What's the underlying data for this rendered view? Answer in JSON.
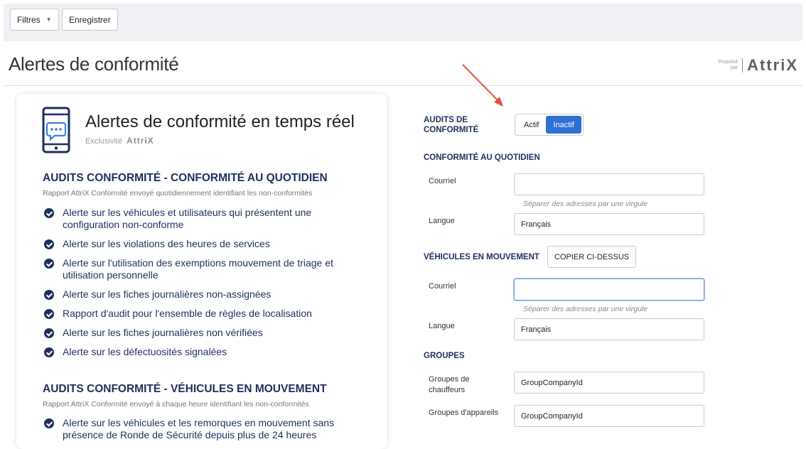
{
  "toolbar": {
    "filters_label": "Filtres",
    "save_label": "Enregistrer"
  },
  "header": {
    "title": "Alertes de conformité",
    "brand_small_line1": "Propulsé",
    "brand_small_line2": "par",
    "brand_logo": "AttriX"
  },
  "card": {
    "title": "Alertes de conformité en temps réel",
    "subtitle_prefix": "Exclusivité",
    "subtitle_logo": "AttriX",
    "sections": [
      {
        "heading": "AUDITS CONFORMITÉ - CONFORMITÉ AU QUOTIDIEN",
        "description": "Rapport AttriX Conformité envoyé quotidiennement identifiant les non-conformités",
        "items": [
          "Alerte sur les véhicules et utilisateurs qui présentent une configuration non-conforme",
          "Alerte sur les violations des heures de services",
          "Alerte sur l'utilisation des exemptions mouvement de triage et utilisation personnelle",
          "Alerte sur les fiches journalières non-assignées",
          "Rapport d'audit pour l'ensemble de règles de localisation",
          "Alerte sur les fiches journalières non vérifiées",
          "Alerte sur les défectuosités signalées"
        ]
      },
      {
        "heading": "AUDITS CONFORMITÉ - VÉHICULES EN MOUVEMENT",
        "description": "Rapport AttriX Conformité envoyé à chaque heure identifiant les non-conformités",
        "items": [
          "Alerte sur les véhicules et les remorques en mouvement sans présence de Ronde de Sécurité depuis plus de 24 heures"
        ]
      }
    ]
  },
  "form": {
    "audits_label": "AUDITS DE CONFORMITÉ",
    "toggle": {
      "on_label": "Actif",
      "off_label": "Inactif",
      "selected": "Inactif"
    },
    "daily": {
      "heading": "CONFORMITÉ AU QUOTIDIEN",
      "email_label": "Courriel",
      "email_value": "",
      "email_hint": "Séparer des adresses par une virgule",
      "language_label": "Langue",
      "language_value": "Français"
    },
    "moving": {
      "heading": "VÉHICULES EN MOUVEMENT",
      "copy_label": "COPIER CI-DESSUS",
      "email_label": "Courriel",
      "email_value": "",
      "email_hint": "Séparer des adresses par une virgule",
      "language_label": "Langue",
      "language_value": "Français"
    },
    "groups": {
      "heading": "GROUPES",
      "drivers_label": "Groupes de chauffeurs",
      "drivers_value": "GroupCompanyId",
      "devices_label": "Groupes d'appareils",
      "devices_value": "GroupCompanyId"
    }
  },
  "colors": {
    "accent": "#2f6fd6",
    "navy": "#1e2f5a",
    "arrow": "#e0553a"
  }
}
